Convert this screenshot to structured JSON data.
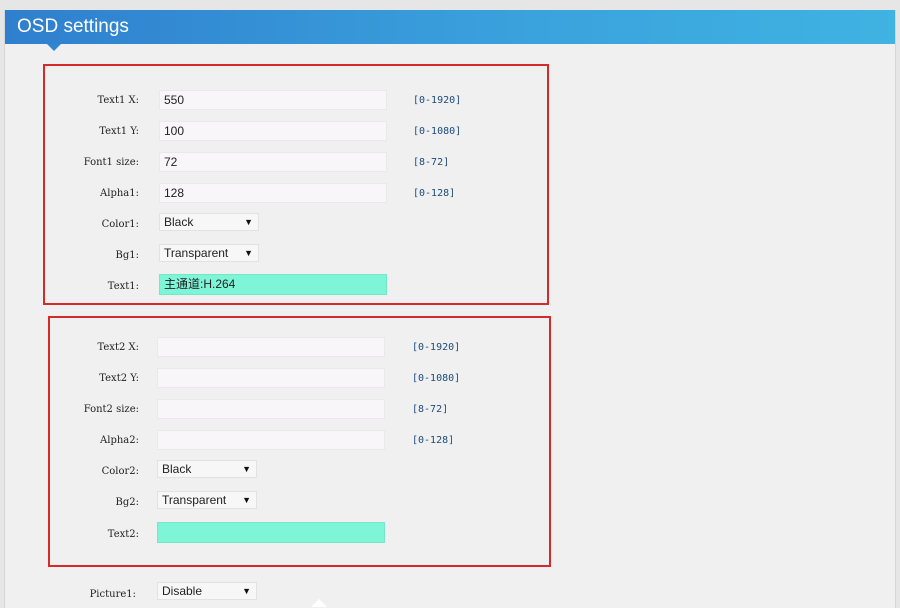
{
  "header": {
    "title": "OSD settings"
  },
  "group1": {
    "text_x": {
      "label": "Text1 X:",
      "value": "550",
      "range": "[0-1920]"
    },
    "text_y": {
      "label": "Text1 Y:",
      "value": "100",
      "range": "[0-1080]"
    },
    "font_size": {
      "label": "Font1 size:",
      "value": "72",
      "range": "[8-72]"
    },
    "alpha": {
      "label": "Alpha1:",
      "value": "128",
      "range": "[0-128]"
    },
    "color": {
      "label": "Color1:",
      "selected": "Black"
    },
    "bg": {
      "label": "Bg1:",
      "selected": "Transparent"
    },
    "text": {
      "label": "Text1:",
      "value": "主通道:H.264"
    }
  },
  "group2": {
    "text_x": {
      "label": "Text2 X:",
      "value": "",
      "range": "[0-1920]"
    },
    "text_y": {
      "label": "Text2 Y:",
      "value": "",
      "range": "[0-1080]"
    },
    "font_size": {
      "label": "Font2 size:",
      "value": "",
      "range": "[8-72]"
    },
    "alpha": {
      "label": "Alpha2:",
      "value": "",
      "range": "[0-128]"
    },
    "color": {
      "label": "Color2:",
      "selected": "Black"
    },
    "bg": {
      "label": "Bg2:",
      "selected": "Transparent"
    },
    "text": {
      "label": "Text2:",
      "value": ""
    }
  },
  "picture": {
    "label": "Picture1:",
    "selected": "Disable"
  },
  "icons": {
    "dropdown": "dropdown-arrow-icon"
  },
  "colors": {
    "header_start": "#2f7fce",
    "header_end": "#3fb3e2",
    "highlight_border": "#d62a2a",
    "text_field_bg": "#7ff5d8",
    "range_text": "#1b4a7a"
  }
}
